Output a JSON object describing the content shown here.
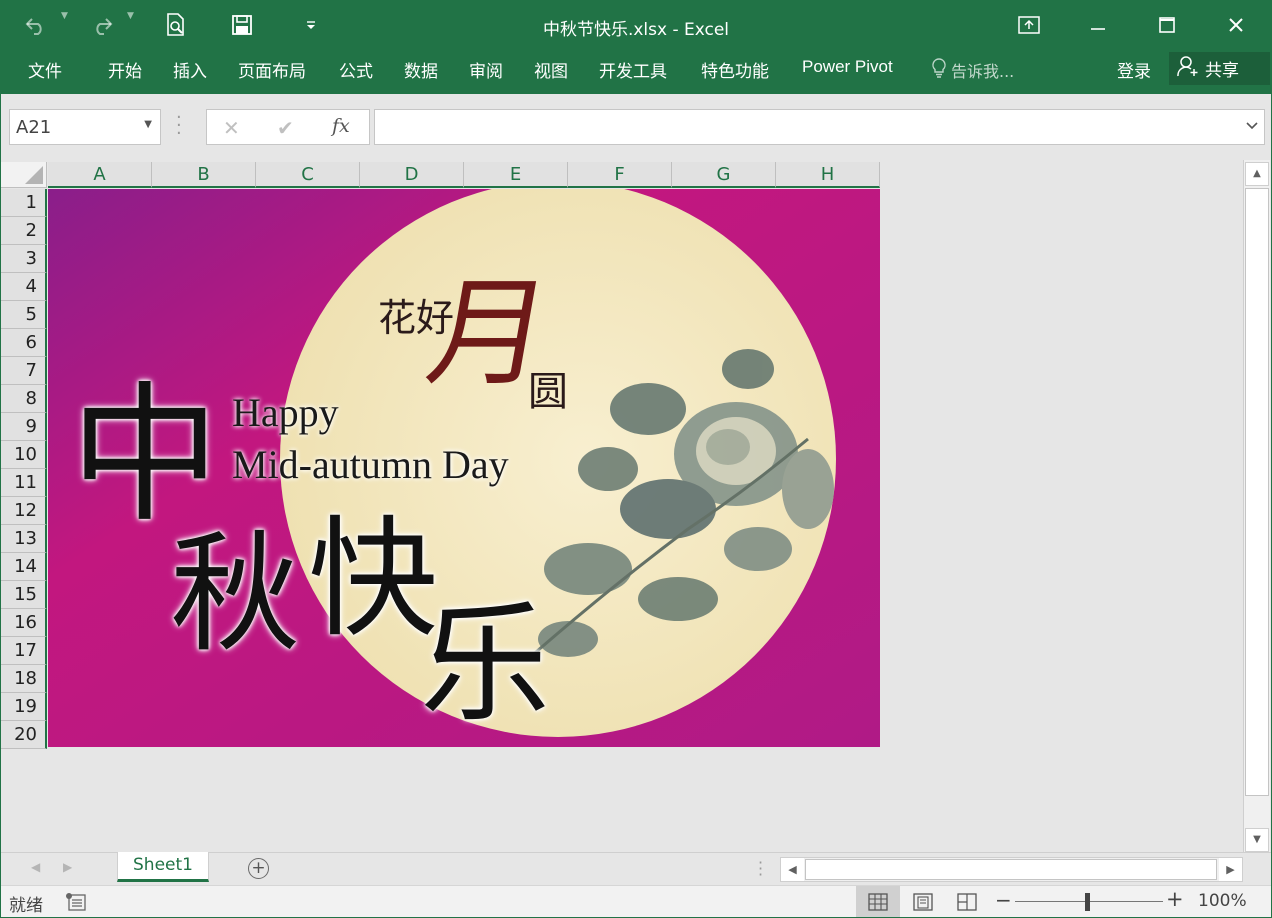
{
  "window": {
    "title": "中秋节快乐.xlsx - Excel"
  },
  "quick_access": {
    "undo_icon": "undo-icon",
    "redo_icon": "redo-icon",
    "print_preview_icon": "print-preview-icon",
    "save_icon": "save-icon",
    "customize_icon": "customize-qat-icon"
  },
  "ribbon": {
    "tabs": [
      "文件",
      "开始",
      "插入",
      "页面布局",
      "公式",
      "数据",
      "审阅",
      "视图",
      "开发工具",
      "特色功能",
      "Power Pivot"
    ],
    "tell_me": "告诉我...",
    "login": "登录",
    "share": "共享"
  },
  "formula_bar": {
    "name_box": "A21",
    "fx_label": "fx",
    "formula_value": ""
  },
  "grid": {
    "columns": [
      "A",
      "B",
      "C",
      "D",
      "E",
      "F",
      "G",
      "H"
    ],
    "rows": [
      "1",
      "2",
      "3",
      "4",
      "5",
      "6",
      "7",
      "8",
      "9",
      "10",
      "11",
      "12",
      "13",
      "14",
      "15",
      "16",
      "17",
      "18",
      "19",
      "20"
    ]
  },
  "picture": {
    "background_color": "#c2177f",
    "moon_color": "#f4e9c4",
    "text_top": "花好",
    "text_moon": "月",
    "text_round": "圆",
    "greeting_line1": "Happy",
    "greeting_line2": "Mid-autumn Day",
    "big_chars": [
      "中",
      "秋",
      "快",
      "乐"
    ]
  },
  "sheets": {
    "tabs": [
      "Sheet1"
    ],
    "active": "Sheet1"
  },
  "status_bar": {
    "ready": "就绪",
    "zoom": "100%"
  },
  "colors": {
    "excel_green": "#217346",
    "share_green": "#1c5f3a"
  }
}
